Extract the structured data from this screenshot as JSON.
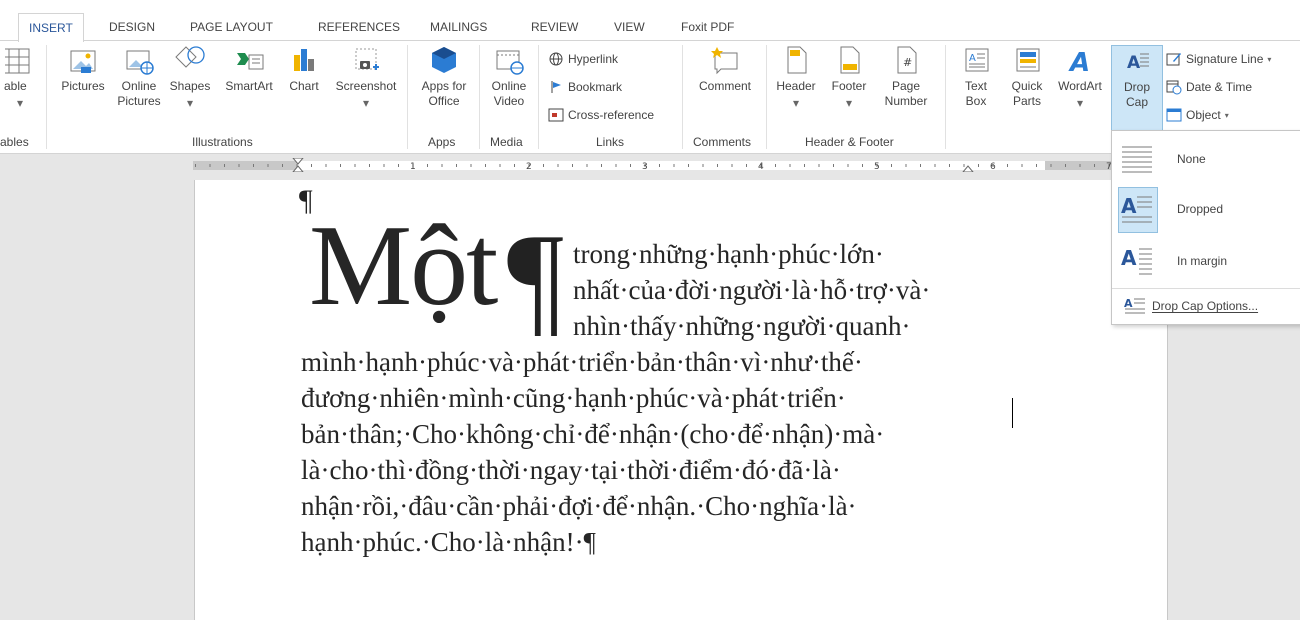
{
  "tabs": [
    "INSERT",
    "DESIGN",
    "PAGE LAYOUT",
    "REFERENCES",
    "MAILINGS",
    "REVIEW",
    "VIEW",
    "Foxit PDF"
  ],
  "ribbon": {
    "table_label": "able",
    "tables_group": "ables",
    "illustrations": {
      "pictures": "Pictures",
      "online_pictures": "Online\nPictures",
      "shapes": "Shapes",
      "smartart": "SmartArt",
      "chart": "Chart",
      "screenshot": "Screenshot",
      "group": "Illustrations"
    },
    "apps": {
      "apps_for_office": "Apps for\nOffice",
      "group": "Apps"
    },
    "media": {
      "online_video": "Online\nVideo",
      "group": "Media"
    },
    "links": {
      "hyperlink": "Hyperlink",
      "bookmark": "Bookmark",
      "cross_reference": "Cross-reference",
      "group": "Links"
    },
    "comments": {
      "comment": "Comment",
      "group": "Comments"
    },
    "header_footer": {
      "header": "Header",
      "footer": "Footer",
      "page_number": "Page\nNumber",
      "group": "Header & Footer"
    },
    "text": {
      "text_box": "Text\nBox",
      "quick_parts": "Quick\nParts",
      "wordart": "WordArt",
      "drop_cap": "Drop\nCap",
      "signature_line": "Signature Line",
      "date_time": "Date & Time",
      "object": "Object"
    }
  },
  "ruler": {
    "numbers": [
      "1",
      "1",
      "2",
      "3",
      "4",
      "5",
      "6",
      "7"
    ]
  },
  "document": {
    "empty_paragraph_mark": "¶",
    "drop_cap": "Một",
    "drop_cap_pilcrow": "¶",
    "lines": [
      "trong·những·hạnh·phúc·lớn·",
      "nhất·của·đời·người·là·hỗ·trợ·và·",
      "nhìn·thấy·những·người·quanh·",
      "mình·hạnh·phúc·và·phát·triển·bản·thân·vì·như·thế·",
      "đương·nhiên·mình·cũng·hạnh·phúc·và·phát·triển·",
      "bản·thân;·Cho·không·chỉ·để·nhận·(cho·để·nhận)·mà·",
      "là·cho·thì·đồng·thời·ngay·tại·thời·điểm·đó·đã·là·",
      "nhận·rồi,·đâu·cần·phải·đợi·để·nhận.·Cho·nghĩa·là·",
      "hạnh·phúc.·Cho·là·nhận!·¶"
    ]
  },
  "dropdown": {
    "none": "None",
    "dropped": "Dropped",
    "in_margin": "In margin",
    "options": "Drop Cap Options..."
  },
  "colors": {
    "accent": "#2b579a",
    "selected_bg": "#cde6f7",
    "selected_border": "#92c0e0"
  }
}
